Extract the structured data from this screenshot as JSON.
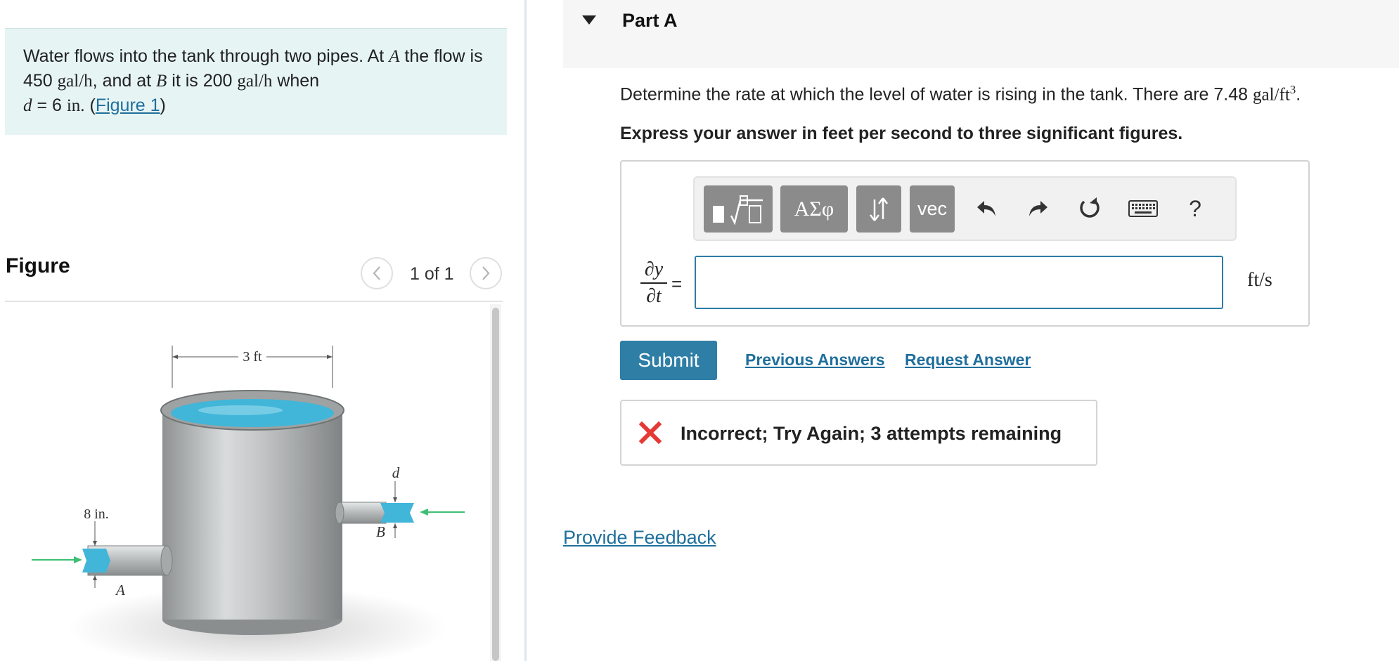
{
  "problem": {
    "text_1": "Water flows into the tank through two pipes. At ",
    "var_a": "A",
    "text_2": " the flow is 450 ",
    "unit_galh": "gal/h",
    "text_3": ", and at ",
    "var_b": "B",
    "text_4": " it is 200 ",
    "text_5": " when",
    "var_d": "d",
    "text_6": " = 6 ",
    "unit_in": "in.",
    "text_7": " (",
    "figure_link": "Figure 1",
    "text_8": ")"
  },
  "figure": {
    "title": "Figure",
    "count": "1 of 1",
    "prev_icon": "chevron-left-icon",
    "next_icon": "chevron-right-icon",
    "labels": {
      "width": "3 ft",
      "pipe_a_dim": "8 in.",
      "point_a": "A",
      "point_b": "B",
      "depth": "d"
    },
    "colors": {
      "arrow": "#3dbf72",
      "water": "#41b6d9",
      "tank": "#b9bcbc"
    }
  },
  "part": {
    "title": "Part A",
    "caret_icon": "caret-down-icon",
    "question_text": "Determine the rate at which the level of water is rising in the tank. There are 7.48 ",
    "question_unit": "gal/ft",
    "question_exp": "3",
    "question_end": ".",
    "instruction": "Express your answer in feet per second to three significant figures."
  },
  "toolbar": {
    "templates_icon": "templates-icon",
    "greek_label": "ΑΣφ",
    "arrows_icon": "up-down-arrows-icon",
    "vec_label": "vec",
    "undo_icon": "undo-icon",
    "redo_icon": "redo-icon",
    "reset_icon": "reset-icon",
    "keyboard_icon": "keyboard-icon",
    "help_label": "?"
  },
  "answer": {
    "numerator": "∂y",
    "denominator": "∂t",
    "equals": "=",
    "value": "",
    "unit": "ft/s"
  },
  "actions": {
    "submit": "Submit",
    "previous_answers": "Previous Answers",
    "request_answer": "Request Answer"
  },
  "feedback": {
    "icon": "x-icon",
    "message": "Incorrect; Try Again; 3 attempts remaining",
    "color": "#e53935"
  },
  "provide_feedback": "Provide Feedback",
  "colors": {
    "accent": "#2f7ea6",
    "problem_bg": "#e6f4f4"
  }
}
